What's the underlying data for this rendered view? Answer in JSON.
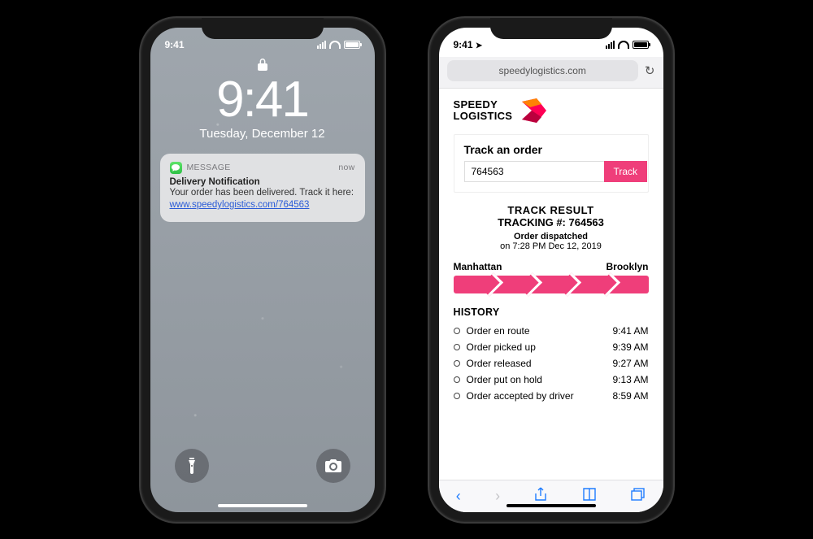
{
  "status": {
    "time": "9:41"
  },
  "lock": {
    "time": "9:41",
    "date": "Tuesday, December 12",
    "notification": {
      "app": "MESSAGE",
      "when": "now",
      "title": "Delivery Notification",
      "body_prefix": "Your order has been delivered. Track it here:",
      "link": "www.speedylogistics.com/764563"
    }
  },
  "browser": {
    "url": "speedylogistics.com",
    "brand1": "SPEEDY",
    "brand2": "LOGISTICS",
    "track": {
      "heading": "Track an order",
      "value": "764563",
      "button": "Track"
    },
    "result": {
      "title": "TRACK RESULT",
      "number_label": "TRACKING #: 764563",
      "dispatched_label": "Order dispatched",
      "dispatched_time": "on 7:28 PM Dec 12, 2019",
      "from": "Manhattan",
      "to": "Brooklyn"
    },
    "history": {
      "heading": "HISTORY",
      "items": [
        {
          "label": "Order en route",
          "time": "9:41 AM"
        },
        {
          "label": "Order picked up",
          "time": "9:39 AM"
        },
        {
          "label": "Order released",
          "time": "9:27 AM"
        },
        {
          "label": "Order put on hold",
          "time": "9:13 AM"
        },
        {
          "label": "Order accepted by driver",
          "time": "8:59 AM"
        }
      ]
    }
  }
}
